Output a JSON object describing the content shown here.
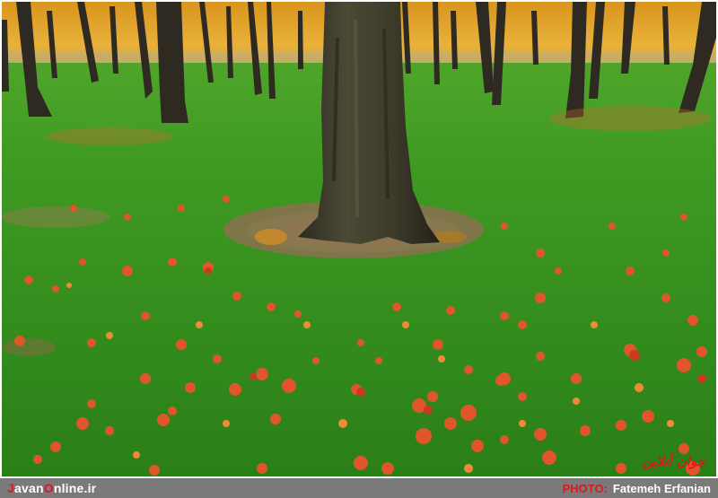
{
  "footer": {
    "site_accent_1": "J",
    "site_part_1": "avan",
    "site_accent_2": "O",
    "site_part_2": "nline.ir",
    "photo_label": "PHOTO:",
    "photographer": "Fatemeh Erfanian"
  },
  "watermark": {
    "text": "جوان آنلاین"
  },
  "colors": {
    "brand_red": "#e0161d",
    "footer_gray": "#7a7a7a",
    "grass": "#2f8a1e",
    "leaf": "#e0552a"
  },
  "scene": {
    "subject": "tree trunk on autumn lawn",
    "icon": "photo-icon"
  }
}
